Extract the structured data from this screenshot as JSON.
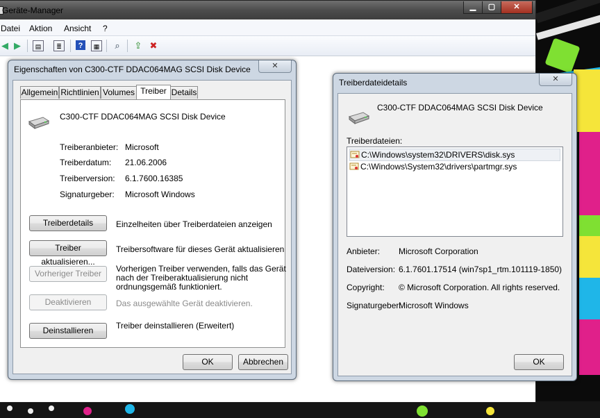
{
  "device_manager": {
    "title": "Geräte-Manager",
    "menu": [
      "Datei",
      "Aktion",
      "Ansicht",
      "?"
    ]
  },
  "properties_dialog": {
    "title": "Eigenschaften von C300-CTF DDAC064MAG SCSI Disk Device",
    "tabs": [
      "Allgemein",
      "Richtlinien",
      "Volumes",
      "Treiber",
      "Details"
    ],
    "selected_tab": "Treiber",
    "device_name": "C300-CTF DDAC064MAG SCSI Disk Device",
    "info": [
      {
        "label": "Treiberanbieter:",
        "value": "Microsoft"
      },
      {
        "label": "Treiberdatum:",
        "value": "21.06.2006"
      },
      {
        "label": "Treiberversion:",
        "value": "6.1.7600.16385"
      },
      {
        "label": "Signaturgeber:",
        "value": "Microsoft Windows"
      }
    ],
    "actions": [
      {
        "button": "Treiberdetails",
        "description": "Einzelheiten über Treiberdateien anzeigen",
        "enabled": true
      },
      {
        "button": "Treiber aktualisieren...",
        "description": "Treibersoftware für dieses Gerät aktualisieren",
        "enabled": true
      },
      {
        "button": "Vorheriger Treiber",
        "description_lines": [
          "Vorherigen Treiber verwenden, falls das Gerät",
          "nach der Treiberaktualisierung nicht",
          "ordnungsgemäß funktioniert."
        ],
        "enabled": false
      },
      {
        "button": "Deaktivieren",
        "description": "Das ausgewählte Gerät deaktivieren.",
        "enabled": false
      },
      {
        "button": "Deinstallieren",
        "description": "Treiber deinstallieren (Erweitert)",
        "enabled": true
      }
    ],
    "ok_label": "OK",
    "cancel_label": "Abbrechen"
  },
  "file_details_dialog": {
    "title": "Treiberdateidetails",
    "device_name": "C300-CTF DDAC064MAG SCSI Disk Device",
    "files_label": "Treiberdateien:",
    "files": [
      "C:\\Windows\\system32\\DRIVERS\\disk.sys",
      "C:\\Windows\\System32\\drivers\\partmgr.sys"
    ],
    "selected_file_index": 0,
    "info": [
      {
        "label": "Anbieter:",
        "value": "Microsoft Corporation"
      },
      {
        "label": "Dateiversion:",
        "value": "6.1.7601.17514 (win7sp1_rtm.101119-1850)"
      },
      {
        "label": "Copyright:",
        "value": "© Microsoft Corporation. All rights reserved."
      },
      {
        "label": "Signaturgeber:",
        "value": "Microsoft Windows"
      }
    ],
    "ok_label": "OK"
  },
  "colors": {
    "accent_green": "#7fe032",
    "accent_yellow": "#f5e53a",
    "accent_magenta": "#e0208a",
    "accent_cyan": "#1fb6e8",
    "dialog_frame": "#cdd7e3"
  }
}
